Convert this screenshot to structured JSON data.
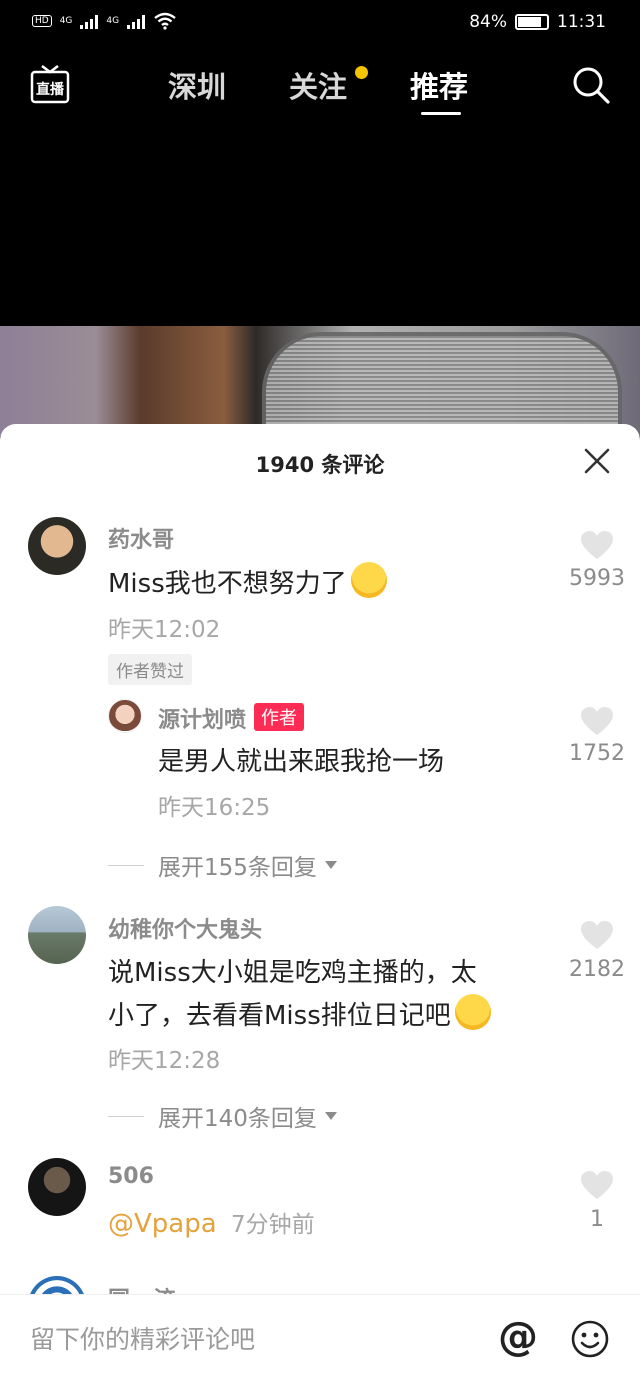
{
  "status_bar": {
    "network_left": "HD",
    "sim1": "4G",
    "sim2": "4G",
    "battery": "84%",
    "battery_level": 0.84,
    "time": "11:31"
  },
  "top_nav": {
    "live_label": "直播",
    "tabs": [
      {
        "label": "深圳"
      },
      {
        "label": "关注"
      },
      {
        "label": "推荐"
      }
    ],
    "active_tab": "推荐",
    "dot_color": "#f5c400"
  },
  "comments_sheet": {
    "title": "1940 条评论",
    "comments": [
      {
        "username": "药水哥",
        "text": "Miss我也不想努力了",
        "time": "昨天12:02",
        "badge": "作者赞过",
        "likes": "5993",
        "reply": {
          "username": "源计划喷",
          "author_tag": "作者",
          "text": "是男人就出来跟我抢一场",
          "time": "昨天16:25",
          "likes": "1752"
        },
        "expand": "展开155条回复"
      },
      {
        "username": "幼稚你个大鬼头",
        "text_line1": "说Miss大小姐是吃鸡主播的，太",
        "text_line2": "小了，去看看Miss排位日记吧",
        "time": "昨天12:28",
        "likes": "2182",
        "expand": "展开140条回复"
      },
      {
        "username": "506",
        "mention": "@Vpapa",
        "time": "7分钟前",
        "likes": "1"
      },
      {
        "username": "国 · 流"
      }
    ]
  },
  "input_bar": {
    "placeholder": "留下你的精彩评论吧",
    "at_symbol": "@",
    "mention_color": "#e6a23c",
    "author_color": "#fe2c55"
  }
}
